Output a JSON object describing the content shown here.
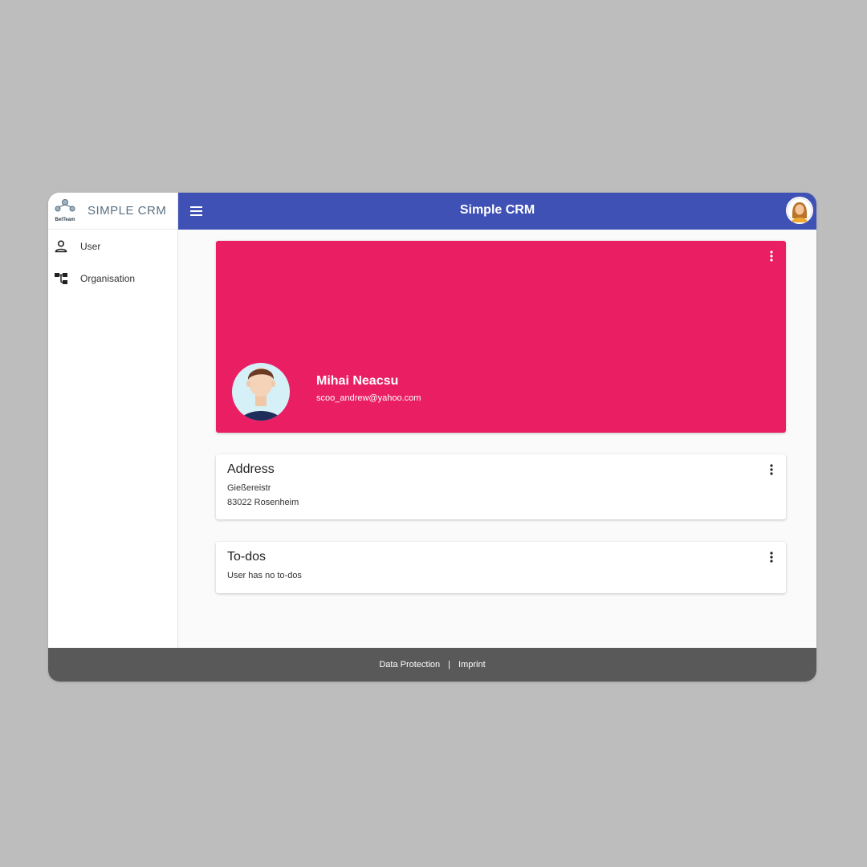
{
  "app": {
    "brand": "SIMPLE CRM",
    "logo_text": "BetTeam",
    "title": "Simple CRM"
  },
  "sidebar": {
    "items": [
      {
        "label": "User",
        "icon": "person-icon"
      },
      {
        "label": "Organisation",
        "icon": "org-chart-icon"
      }
    ]
  },
  "profile": {
    "name": "Mihai Neacsu",
    "email": "scoo_andrew@yahoo.com"
  },
  "address": {
    "title": "Address",
    "street": "Gießereistr",
    "city": "83022 Rosenheim"
  },
  "todos": {
    "title": "To-dos",
    "empty": "User has no to-dos"
  },
  "footer": {
    "data_protection": "Data Protection",
    "separator": "|",
    "imprint": "Imprint"
  },
  "colors": {
    "topbar": "#3f51b5",
    "hero": "#e91e63",
    "footer": "#595959"
  }
}
